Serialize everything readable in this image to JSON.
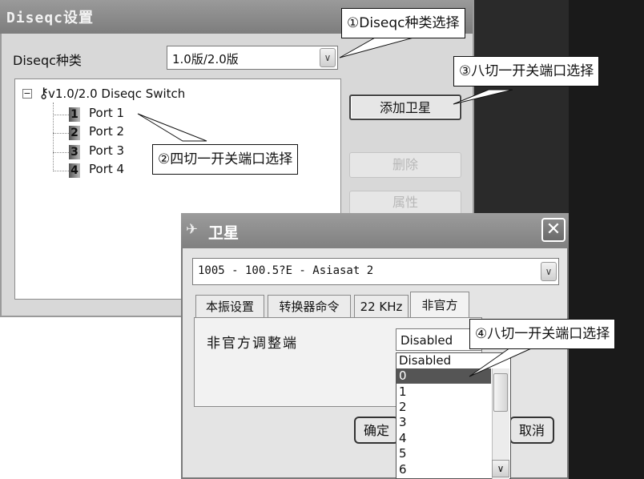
{
  "main_dialog": {
    "title": "Diseqc设置",
    "type_label": "Diseqc种类",
    "type_value": "1.0版/2.0版",
    "tree": {
      "root": "v1.0/2.0 Diseqc Switch",
      "ports": [
        {
          "num": "1",
          "label": "Port 1"
        },
        {
          "num": "2",
          "label": "Port 2"
        },
        {
          "num": "3",
          "label": "Port 3"
        },
        {
          "num": "4",
          "label": "Port 4"
        }
      ]
    },
    "buttons": {
      "add": "添加卫星",
      "delete": "删除",
      "properties": "属性"
    }
  },
  "satellite_dialog": {
    "title": "卫星",
    "close": "✕",
    "satellite_value": "1005 - 100.5?E - Asiasat 2",
    "tabs": [
      "本振设置",
      "转换器命令",
      "22 KHz",
      "非官方"
    ],
    "active_tab": "非官方",
    "setting_label": "非官方调整端",
    "setting_value": "Disabled",
    "ok_label": "确定",
    "cancel_label": "取消",
    "options": [
      "Disabled",
      "0",
      "1",
      "2",
      "3",
      "4",
      "5",
      "6"
    ],
    "selected_option": "0"
  },
  "callouts": {
    "c1": "①Diseqc种类选择",
    "c2": "②四切一开关端口选择",
    "c3": "③八切一开关端口选择",
    "c4": "④八切一开关端口选择"
  },
  "icons": {
    "dropdown": "chevron-down-icon",
    "key": "key-icon",
    "satellite": "satellite-icon"
  }
}
